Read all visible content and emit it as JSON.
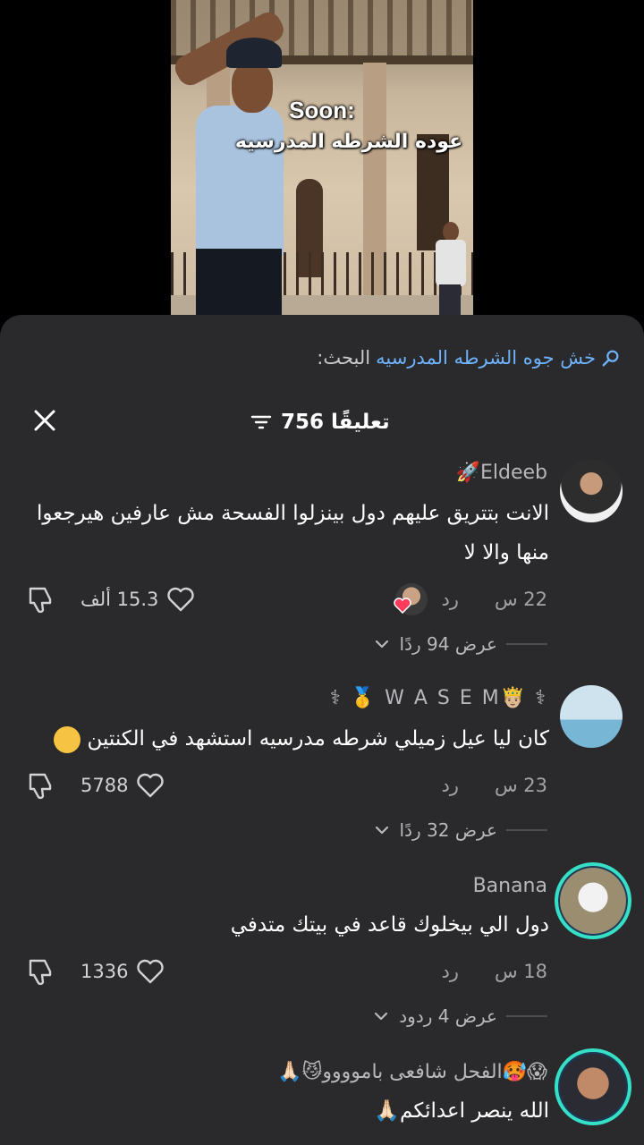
{
  "video": {
    "caption_line1": "Soon:",
    "caption_line2": "عوده الشرطه المدرسيه"
  },
  "search": {
    "prefix": "البحث:",
    "query": "خش جوه الشرطه المدرسيه",
    "icon": "search-icon"
  },
  "header": {
    "comment_count": "756 تعليقًا",
    "filter_icon": "filter-icon",
    "close_icon": "close-icon"
  },
  "comments": [
    {
      "username": "Eldeeb🚀",
      "text": "الانت بتتريق عليهم دول بينزلوا الفسحة مش عارفين هيرجعوا منها والا لا",
      "time": "22 س",
      "reply_label": "رد",
      "likes": "15.3 ألف",
      "view_replies": "عرض 94 ردًا"
    },
    {
      "username": "⚕ 🤴🏼W A S E M 🥇 ⚕",
      "text": "كان ليا عيل زميلي شرطه مدرسيه استشهد في الكنتين",
      "time": "23 س",
      "reply_label": "رد",
      "likes": "5788",
      "view_replies": "عرض 32 ردًا"
    },
    {
      "username": "Banana",
      "text": "دول الي بيخلوك قاعد في بيتك متدفي",
      "time": "18 س",
      "reply_label": "رد",
      "likes": "1336",
      "view_replies": "عرض 4 ردود"
    },
    {
      "username": "😱🥵الفحل شافعى باموووو😼🙏🏻",
      "text": "الله ينصر اعدائكم🙏🏻"
    }
  ],
  "colors": {
    "sheet_bg": "#2a2a2c",
    "accent_link": "#6fb3ff",
    "ring": "#35e0c6"
  }
}
